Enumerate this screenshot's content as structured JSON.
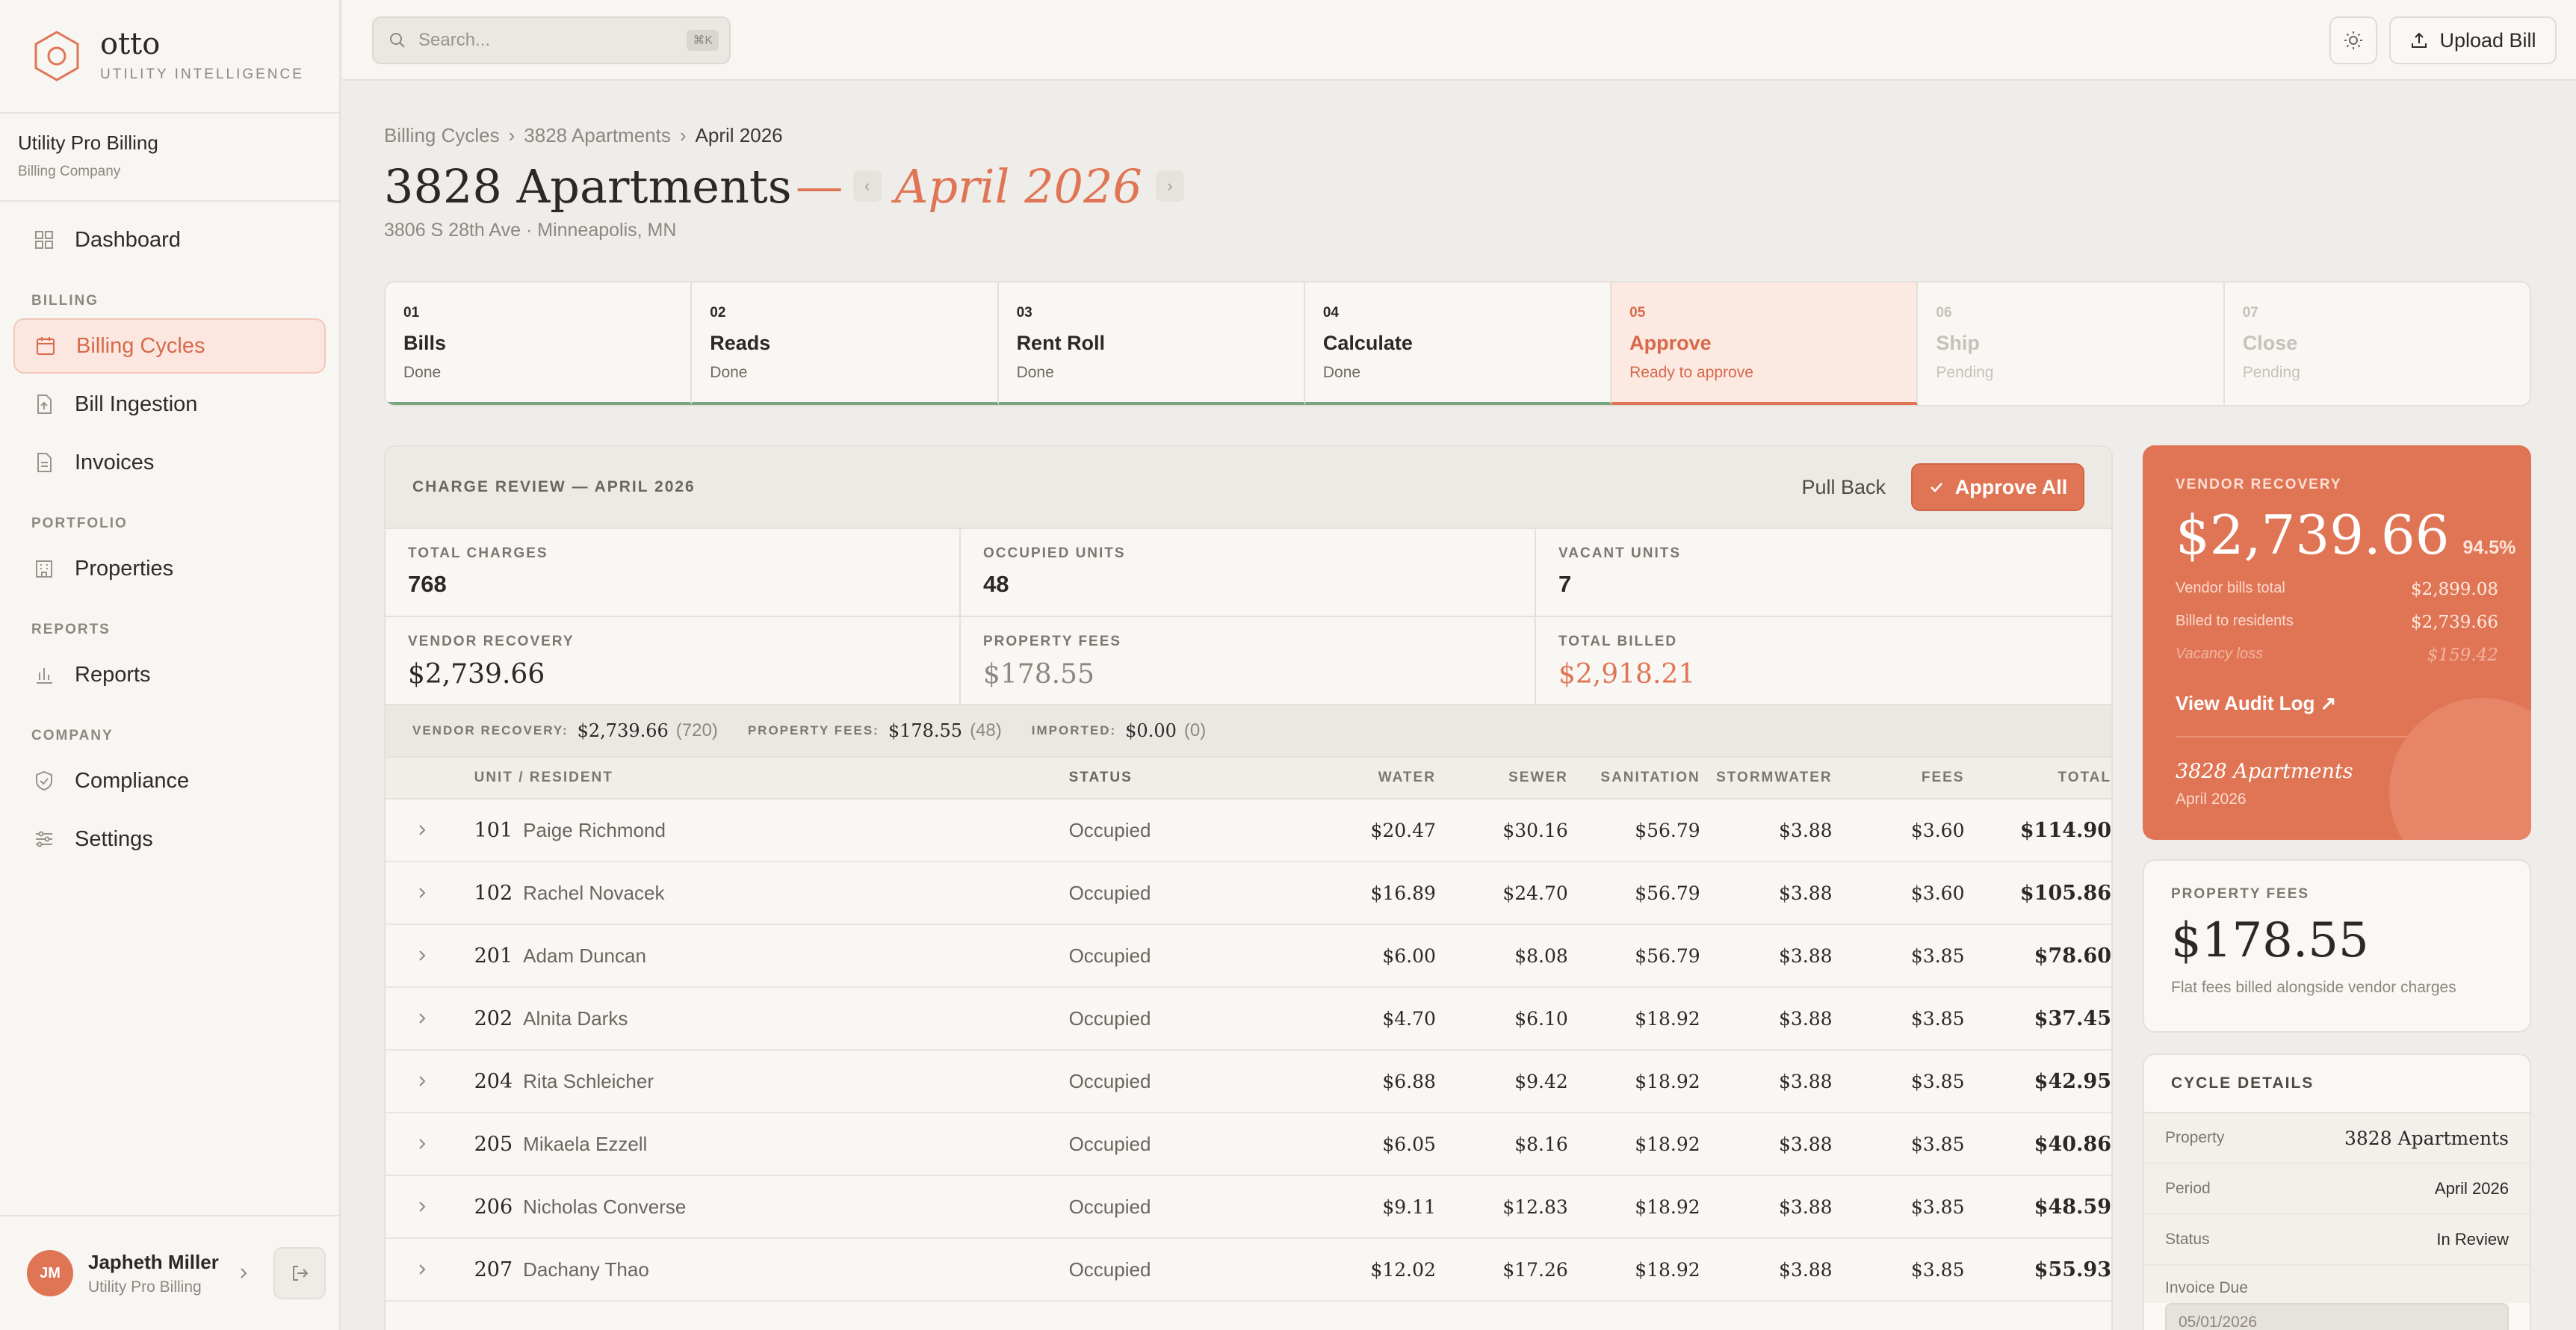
{
  "brand": {
    "name": "otto",
    "tagline": "UTILITY INTELLIGENCE"
  },
  "org": {
    "name": "Utility Pro Billing",
    "type": "Billing Company"
  },
  "nav": {
    "dashboard": "Dashboard",
    "billing_section": "BILLING",
    "billing_cycles": "Billing Cycles",
    "bill_ingestion": "Bill Ingestion",
    "invoices": "Invoices",
    "portfolio_section": "PORTFOLIO",
    "properties": "Properties",
    "reports_section": "REPORTS",
    "reports": "Reports",
    "company_section": "COMPANY",
    "compliance": "Compliance",
    "settings": "Settings"
  },
  "user": {
    "initials": "JM",
    "name": "Japheth Miller",
    "org": "Utility Pro Billing"
  },
  "topbar": {
    "search_placeholder": "Search...",
    "shortcut": "⌘K",
    "upload_label": "Upload Bill"
  },
  "breadcrumb": {
    "root": "Billing Cycles",
    "property": "3828 Apartments",
    "current": "April 2026"
  },
  "header": {
    "title": "3828 Apartments",
    "dash": "—",
    "period": "April 2026",
    "prev": "‹",
    "next": "›",
    "address": "3806 S 28th Ave · Minneapolis, MN"
  },
  "steps": [
    {
      "num": "01",
      "name": "Bills",
      "status": "Done"
    },
    {
      "num": "02",
      "name": "Reads",
      "status": "Done"
    },
    {
      "num": "03",
      "name": "Rent Roll",
      "status": "Done"
    },
    {
      "num": "04",
      "name": "Calculate",
      "status": "Done"
    },
    {
      "num": "05",
      "name": "Approve",
      "status": "Ready to approve"
    },
    {
      "num": "06",
      "name": "Ship",
      "status": "Pending"
    },
    {
      "num": "07",
      "name": "Close",
      "status": "Pending"
    }
  ],
  "review": {
    "title": "CHARGE REVIEW — APRIL 2026",
    "pull_back": "Pull Back",
    "approve_all": "Approve All",
    "stats": {
      "total_charges_label": "TOTAL CHARGES",
      "total_charges": "768",
      "occupied_label": "OCCUPIED UNITS",
      "occupied": "48",
      "vacant_label": "VACANT UNITS",
      "vacant": "7",
      "vendor_recovery_label": "VENDOR RECOVERY",
      "vendor_recovery": "$2,739.66",
      "property_fees_label": "PROPERTY FEES",
      "property_fees": "$178.55",
      "total_billed_label": "TOTAL BILLED",
      "total_billed": "$2,918.21"
    },
    "summary": {
      "vr_label": "VENDOR RECOVERY:",
      "vr_value": "$2,739.66",
      "vr_count": "(720)",
      "pf_label": "PROPERTY FEES:",
      "pf_value": "$178.55",
      "pf_count": "(48)",
      "im_label": "IMPORTED:",
      "im_value": "$0.00",
      "im_count": "(0)"
    },
    "columns": {
      "unit": "UNIT / RESIDENT",
      "status": "STATUS",
      "water": "WATER",
      "sewer": "SEWER",
      "sanitation": "SANITATION",
      "stormwater": "STORMWATER",
      "fees": "FEES",
      "total": "TOTAL"
    },
    "rows": [
      {
        "unit": "101",
        "resident": "Paige Richmond",
        "status": "Occupied",
        "water": "$20.47",
        "sewer": "$30.16",
        "sanitation": "$56.79",
        "stormwater": "$3.88",
        "fees": "$3.60",
        "total": "$114.90"
      },
      {
        "unit": "102",
        "resident": "Rachel Novacek",
        "status": "Occupied",
        "water": "$16.89",
        "sewer": "$24.70",
        "sanitation": "$56.79",
        "stormwater": "$3.88",
        "fees": "$3.60",
        "total": "$105.86"
      },
      {
        "unit": "201",
        "resident": "Adam Duncan",
        "status": "Occupied",
        "water": "$6.00",
        "sewer": "$8.08",
        "sanitation": "$56.79",
        "stormwater": "$3.88",
        "fees": "$3.85",
        "total": "$78.60"
      },
      {
        "unit": "202",
        "resident": "Alnita Darks",
        "status": "Occupied",
        "water": "$4.70",
        "sewer": "$6.10",
        "sanitation": "$18.92",
        "stormwater": "$3.88",
        "fees": "$3.85",
        "total": "$37.45"
      },
      {
        "unit": "204",
        "resident": "Rita Schleicher",
        "status": "Occupied",
        "water": "$6.88",
        "sewer": "$9.42",
        "sanitation": "$18.92",
        "stormwater": "$3.88",
        "fees": "$3.85",
        "total": "$42.95"
      },
      {
        "unit": "205",
        "resident": "Mikaela Ezzell",
        "status": "Occupied",
        "water": "$6.05",
        "sewer": "$8.16",
        "sanitation": "$18.92",
        "stormwater": "$3.88",
        "fees": "$3.85",
        "total": "$40.86"
      },
      {
        "unit": "206",
        "resident": "Nicholas Converse",
        "status": "Occupied",
        "water": "$9.11",
        "sewer": "$12.83",
        "sanitation": "$18.92",
        "stormwater": "$3.88",
        "fees": "$3.85",
        "total": "$48.59"
      },
      {
        "unit": "207",
        "resident": "Dachany Thao",
        "status": "Occupied",
        "water": "$12.02",
        "sewer": "$17.26",
        "sanitation": "$18.92",
        "stormwater": "$3.88",
        "fees": "$3.85",
        "total": "$55.93"
      }
    ]
  },
  "vendor_card": {
    "label": "VENDOR RECOVERY",
    "amount": "$2,739.66",
    "pct": "94.5%",
    "bills_label": "Vendor bills total",
    "bills_value": "$2,899.08",
    "billed_label": "Billed to residents",
    "billed_value": "$2,739.66",
    "vacancy_label": "Vacancy loss",
    "vacancy_value": "$159.42",
    "link": "View Audit Log ↗",
    "property": "3828 Apartments",
    "period": "April 2026"
  },
  "fees_card": {
    "label": "PROPERTY FEES",
    "amount": "$178.55",
    "sub": "Flat fees billed alongside vendor charges"
  },
  "details": {
    "title": "CYCLE DETAILS",
    "property_label": "Property",
    "property": "3828 Apartments",
    "period_label": "Period",
    "period": "April 2026",
    "status_label": "Status",
    "status": "In Review",
    "invoice_due_label": "Invoice Due",
    "invoice_due": "05/01/2026"
  },
  "colors": {
    "accent": "#e07555",
    "done": "#7aa67f",
    "sidebar_bg": "#f8f6f2",
    "page_bg": "#efedea"
  }
}
